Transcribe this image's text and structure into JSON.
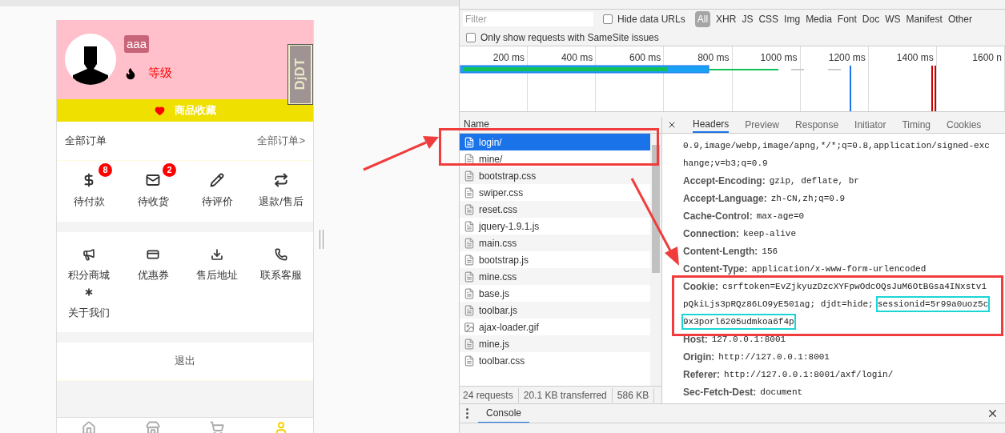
{
  "phone": {
    "user": {
      "name": "aaa",
      "level_label": "等级"
    },
    "favorites": "商品收藏",
    "debug_tab": "DjDT",
    "orders": {
      "title": "全部订单",
      "link": "全部订单>"
    },
    "order_items": [
      {
        "label": "待付款",
        "badge": "8"
      },
      {
        "label": "待收货",
        "badge": "2"
      },
      {
        "label": "待评价"
      },
      {
        "label": "退款/售后"
      }
    ],
    "services": [
      {
        "label": "积分商城"
      },
      {
        "label": "优惠券"
      },
      {
        "label": "售后地址"
      },
      {
        "label": "联系客服"
      },
      {
        "label": "关于我们"
      }
    ],
    "logout": "退出"
  },
  "devtools": {
    "filter": {
      "placeholder": "Filter",
      "hide_data_urls": {
        "label": "Hide data URLs",
        "checked": false
      },
      "types": [
        {
          "label": "All",
          "selected": true
        },
        {
          "label": "XHR",
          "selected": false
        },
        {
          "label": "JS",
          "selected": false
        },
        {
          "label": "CSS",
          "selected": false
        },
        {
          "label": "Img",
          "selected": false
        },
        {
          "label": "Media",
          "selected": false
        },
        {
          "label": "Font",
          "selected": false
        },
        {
          "label": "Doc",
          "selected": false
        },
        {
          "label": "WS",
          "selected": false
        },
        {
          "label": "Manifest",
          "selected": false
        },
        {
          "label": "Other",
          "selected": false
        }
      ],
      "samesite": {
        "label": "Only show requests with SameSite issues",
        "checked": false
      }
    },
    "timeline_ticks": [
      "200 ms",
      "400 ms",
      "600 ms",
      "800 ms",
      "1000 ms",
      "1200 ms",
      "1400 ms",
      "1600 n"
    ],
    "requests": {
      "column": "Name",
      "rows": [
        {
          "name": "login/",
          "kind": "document",
          "selected": true
        },
        {
          "name": "mine/",
          "kind": "document",
          "selected": false
        },
        {
          "name": "bootstrap.css",
          "kind": "document",
          "selected": false
        },
        {
          "name": "swiper.css",
          "kind": "document",
          "selected": false
        },
        {
          "name": "reset.css",
          "kind": "document",
          "selected": false
        },
        {
          "name": "jquery-1.9.1.js",
          "kind": "document",
          "selected": false
        },
        {
          "name": "main.css",
          "kind": "document",
          "selected": false
        },
        {
          "name": "bootstrap.js",
          "kind": "document",
          "selected": false
        },
        {
          "name": "mine.css",
          "kind": "document",
          "selected": false
        },
        {
          "name": "base.js",
          "kind": "document",
          "selected": false
        },
        {
          "name": "toolbar.js",
          "kind": "document",
          "selected": false
        },
        {
          "name": "ajax-loader.gif",
          "kind": "image",
          "selected": false
        },
        {
          "name": "mine.js",
          "kind": "document",
          "selected": false
        },
        {
          "name": "toolbar.css",
          "kind": "document",
          "selected": false
        }
      ],
      "summary": [
        "24 requests",
        "20.1 KB transferred",
        "586 KB"
      ]
    },
    "detail_tabs": [
      {
        "label": "Headers",
        "selected": true
      },
      {
        "label": "Preview",
        "selected": false
      },
      {
        "label": "Response",
        "selected": false
      },
      {
        "label": "Initiator",
        "selected": false
      },
      {
        "label": "Timing",
        "selected": false
      },
      {
        "label": "Cookies",
        "selected": false
      }
    ],
    "header_lines": [
      {
        "value": "0.9,image/webp,image/apng,*/*;q=0.8,application/signed-exc"
      },
      {
        "value": "hange;v=b3;q=0.9"
      },
      {
        "name": "Accept-Encoding:",
        "value": "gzip, deflate, br"
      },
      {
        "name": "Accept-Language:",
        "value": "zh-CN,zh;q=0.9"
      },
      {
        "name": "Cache-Control:",
        "value": "max-age=0"
      },
      {
        "name": "Connection:",
        "value": "keep-alive"
      },
      {
        "name": "Content-Length:",
        "value": "156"
      },
      {
        "name": "Content-Type:",
        "value": "application/x-www-form-urlencoded"
      },
      {
        "name": "Cookie:",
        "value": "csrftoken=EvZjkyuzDzcXYFpwOdcOQsJuM6OtBGsa4INxstv1"
      },
      {
        "value": "pQkiLjs3pRQz86LO9yE501ag; djdt=hide;",
        "marked": "sessionid=5r99a0uoz5c"
      },
      {
        "marked": "9x3porl6205udmkoa6f4p"
      },
      {
        "name": "Host:",
        "value": "127.0.0.1:8001"
      },
      {
        "name": "Origin:",
        "value": "http://127.0.0.1:8001"
      },
      {
        "name": "Referer:",
        "value": "http://127.0.0.1:8001/axf/login/"
      },
      {
        "name": "Sec-Fetch-Dest:",
        "value": "document"
      }
    ],
    "drawer_tab": "Console"
  }
}
